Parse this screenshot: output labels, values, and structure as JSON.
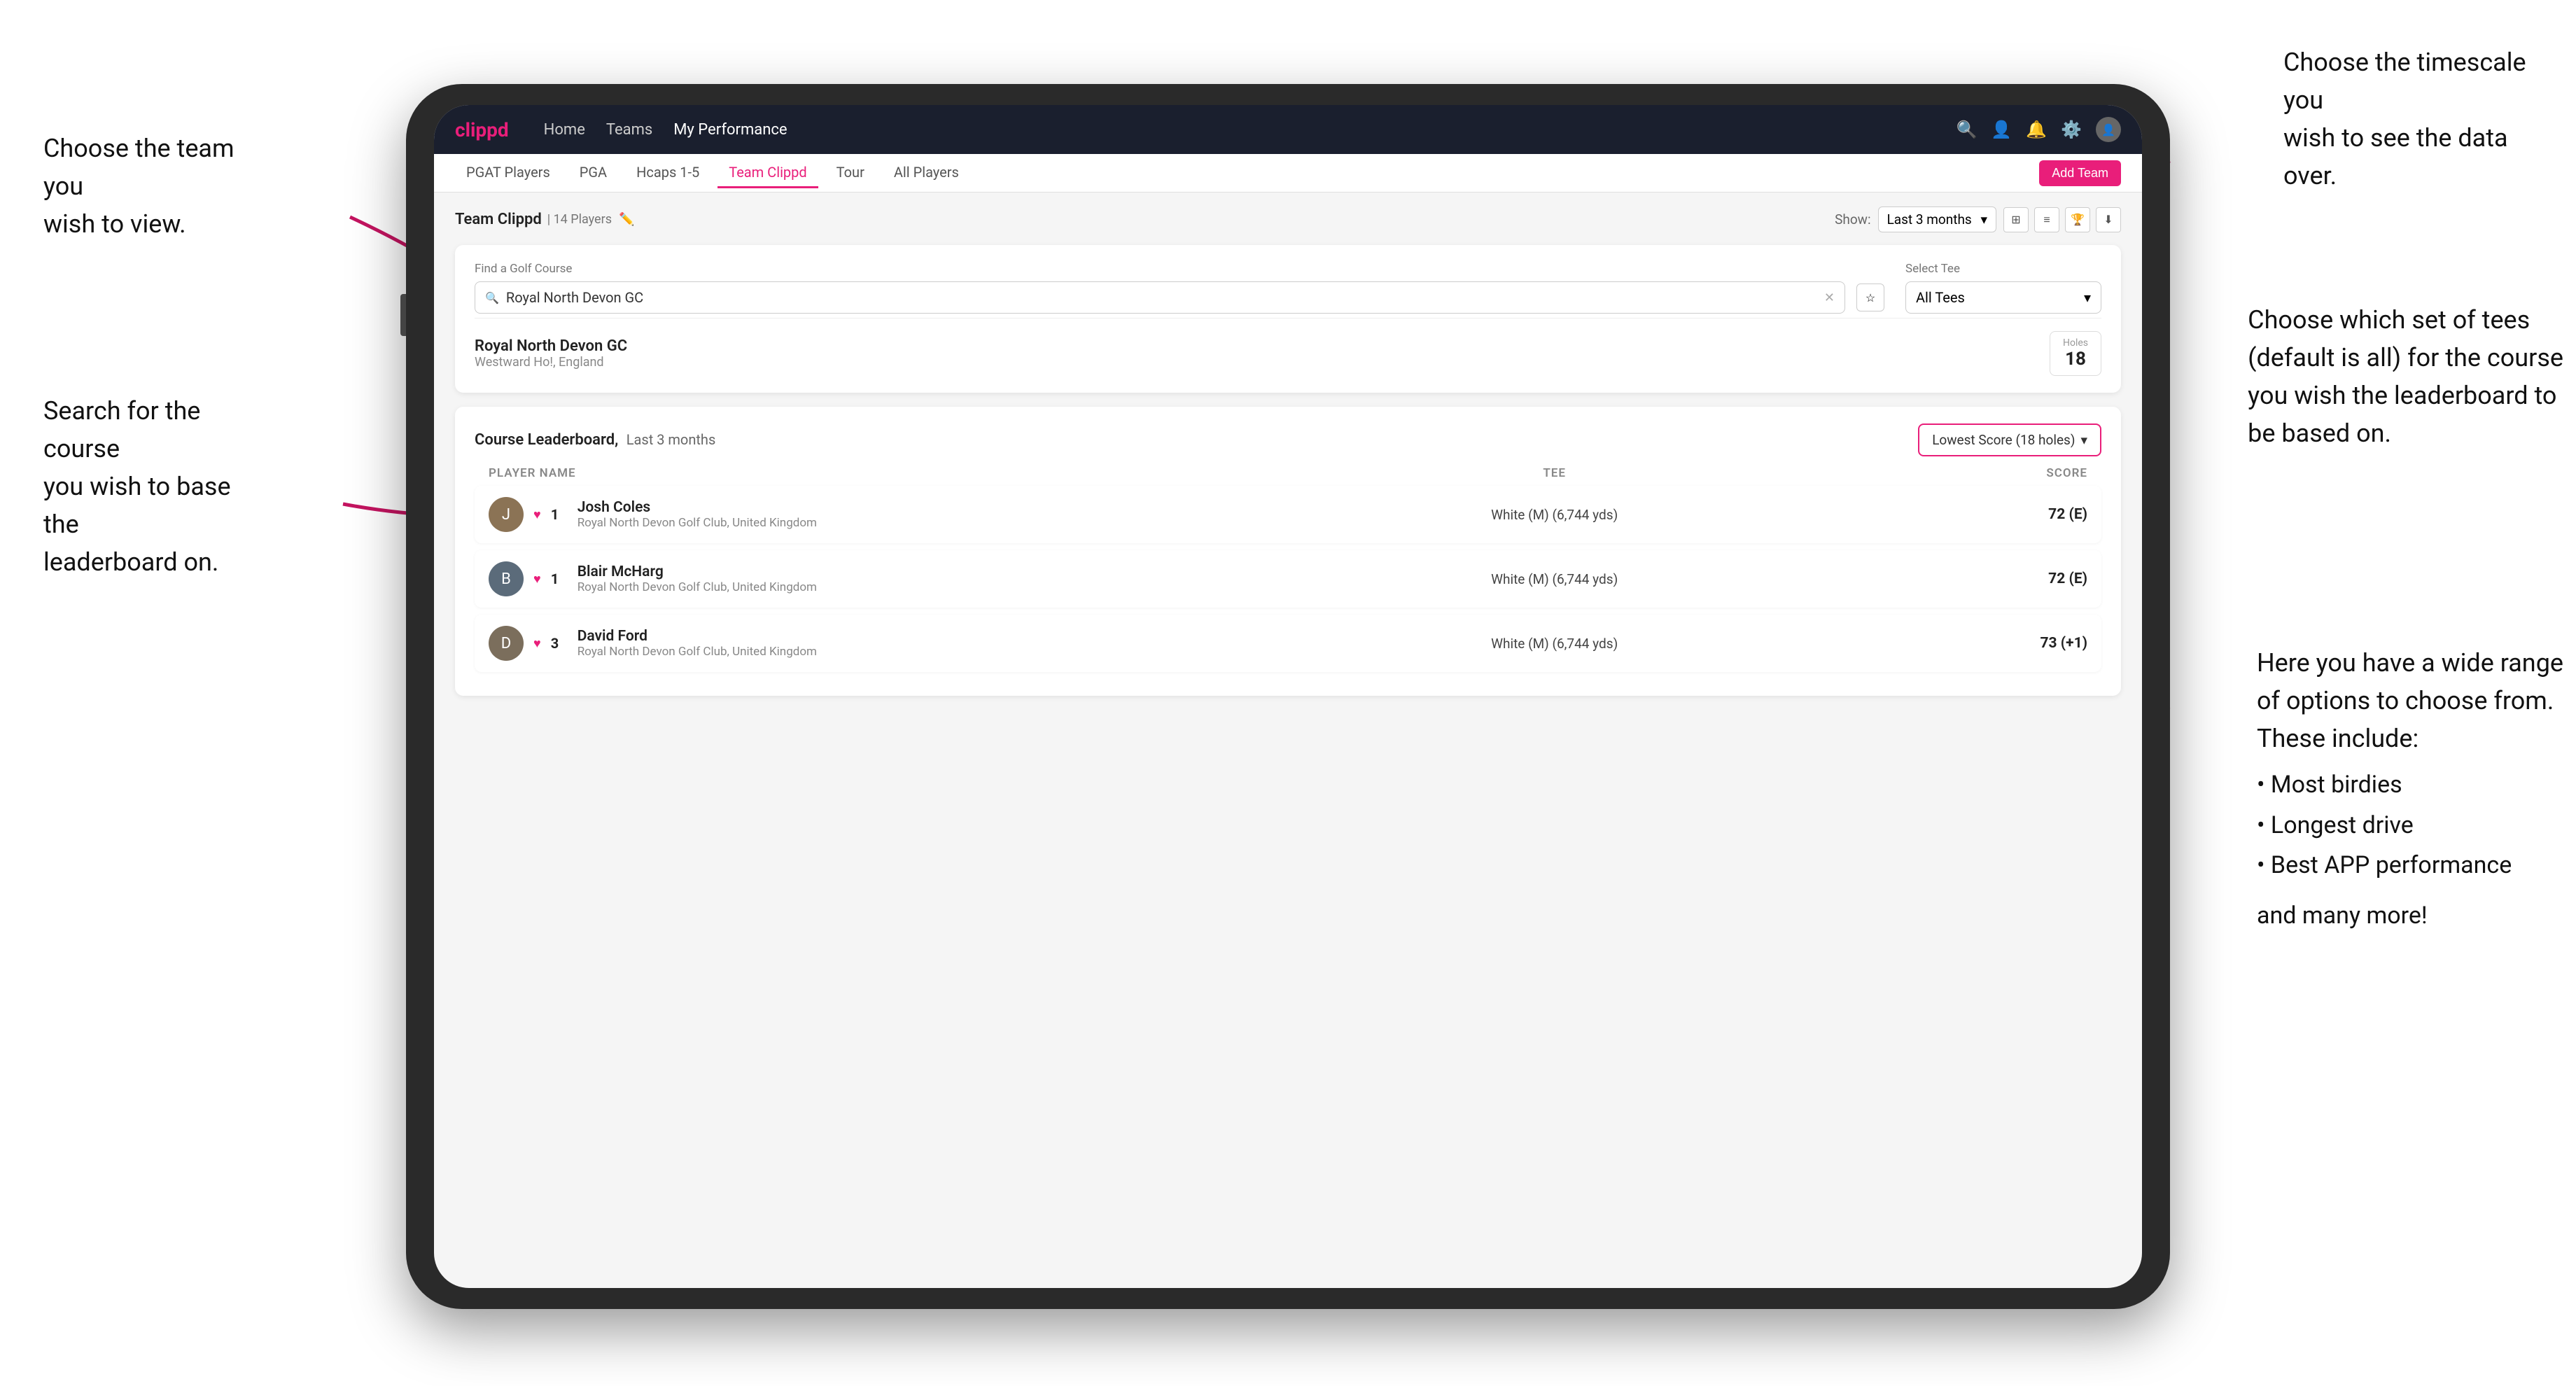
{
  "annotations": {
    "team_choice": "Choose the team you\nwish to view.",
    "timescale_choice": "Choose the timescale you\nwish to see the data over.",
    "tees_choice": "Choose which set of tees\n(default is all) for the course\nyou wish the leaderboard to\nbe based on.",
    "search_course": "Search for the course\nyou wish to base the\nleaderboard on.",
    "options_title": "Here you have a wide range\nof options to choose from.\nThese include:",
    "options_list": [
      "Most birdies",
      "Longest drive",
      "Best APP performance"
    ],
    "and_more": "and many more!"
  },
  "nav": {
    "logo": "clippd",
    "links": [
      "Home",
      "Teams",
      "My Performance"
    ],
    "active_link": "My Performance"
  },
  "tabs": {
    "items": [
      "PGAT Players",
      "PGA",
      "Hcaps 1-5",
      "Team Clippd",
      "Tour",
      "All Players"
    ],
    "active": "Team Clippd",
    "add_team_label": "Add Team"
  },
  "team_header": {
    "title": "Team Clippd",
    "player_count": "14 Players",
    "show_label": "Show:",
    "show_value": "Last 3 months"
  },
  "course_search": {
    "find_label": "Find a Golf Course",
    "search_value": "Royal North Devon GC",
    "select_tee_label": "Select Tee",
    "tee_value": "All Tees"
  },
  "course_result": {
    "name": "Royal North Devon GC",
    "location": "Westward Ho!, England",
    "holes_label": "Holes",
    "holes_value": "18"
  },
  "leaderboard": {
    "title": "Course Leaderboard,",
    "title_sub": "Last 3 months",
    "score_dropdown": "Lowest Score (18 holes)",
    "columns": {
      "player": "PLAYER NAME",
      "tee": "TEE",
      "score": "SCORE"
    },
    "players": [
      {
        "rank": "1",
        "name": "Josh Coles",
        "club": "Royal North Devon Golf Club, United Kingdom",
        "tee": "White (M) (6,744 yds)",
        "score": "72 (E)"
      },
      {
        "rank": "1",
        "name": "Blair McHarg",
        "club": "Royal North Devon Golf Club, United Kingdom",
        "tee": "White (M) (6,744 yds)",
        "score": "72 (E)"
      },
      {
        "rank": "3",
        "name": "David Ford",
        "club": "Royal North Devon Golf Club, United Kingdom",
        "tee": "White (M) (6,744 yds)",
        "score": "73 (+1)"
      }
    ]
  },
  "colors": {
    "brand_pink": "#e91e7a",
    "nav_bg": "#1a1f2e",
    "text_dark": "#222222",
    "text_mid": "#555555",
    "text_light": "#888888"
  }
}
